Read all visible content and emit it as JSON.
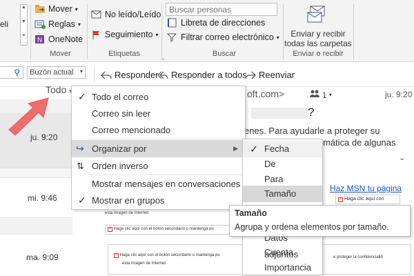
{
  "ribbon": {
    "partial_left": "eli",
    "move": {
      "mover": "Mover",
      "reglas": "Reglas",
      "onenote": "OneNote",
      "label": "Mover"
    },
    "tags": {
      "unread": "No leído/Leído",
      "followup": "Seguimiento",
      "label": "Etiquetas"
    },
    "search": {
      "placeholder": "Buscar personas",
      "addressbook": "Libreta de direcciones",
      "filter": "Filtrar correo electrónico",
      "label": "Buscar"
    },
    "sendreceive": {
      "line1": "Enviar y recibir",
      "line2": "todas las carpetas",
      "label": "Enviar o recibir"
    }
  },
  "cmdbar": {
    "mailbox": "Buzón actual",
    "reply": "Responder",
    "replyall": "Responder a todos",
    "forward": "Reenviar"
  },
  "list": {
    "filter": "Todo",
    "rows": [
      {
        "time": "ju. 9:20"
      },
      {
        "time": "mi. 9:46"
      },
      {
        "time": "ma. 9:09"
      }
    ]
  },
  "reading": {
    "sender_fragment": "oft.com>",
    "people_count": "1",
    "time": "ju. 9:20",
    "question": "?",
    "body_line1": "enes. Para ayudarle a proteger su",
    "body_line2": "mática de algunas",
    "msn_link": "Haz MSN tu página",
    "img_text1": "Haga clic aquí con",
    "img_text2": "esta imagen de Internet.",
    "img_text3": "Haga clic aquí con el botón secundario o mantenga pu",
    "img_text4": "Haga clic aquí con el botón secundario o mantenga pu",
    "img_text5": "e proteger la confidencialid",
    "img_text6": "esta imagen de Internet."
  },
  "menu": {
    "items": [
      "Todo el correo",
      "Correo sin leer",
      "Correo mencionado",
      "Organizar por",
      "Orden inverso",
      "Mostrar mensajes en conversaciones",
      "Mostrar en grupos"
    ]
  },
  "submenu": {
    "items": [
      "Fecha",
      "De",
      "Para",
      "Tamaño",
      "Datos adjuntos",
      "Cuenta",
      "Importancia"
    ]
  },
  "tooltip": {
    "title": "Tamaño",
    "desc": "Agrupa y ordena elementos por tamaño."
  },
  "colors": {
    "accent": "#2b579a",
    "link": "#1a56c2",
    "arrow": "#f06d6d",
    "highlight": "#dadada"
  }
}
